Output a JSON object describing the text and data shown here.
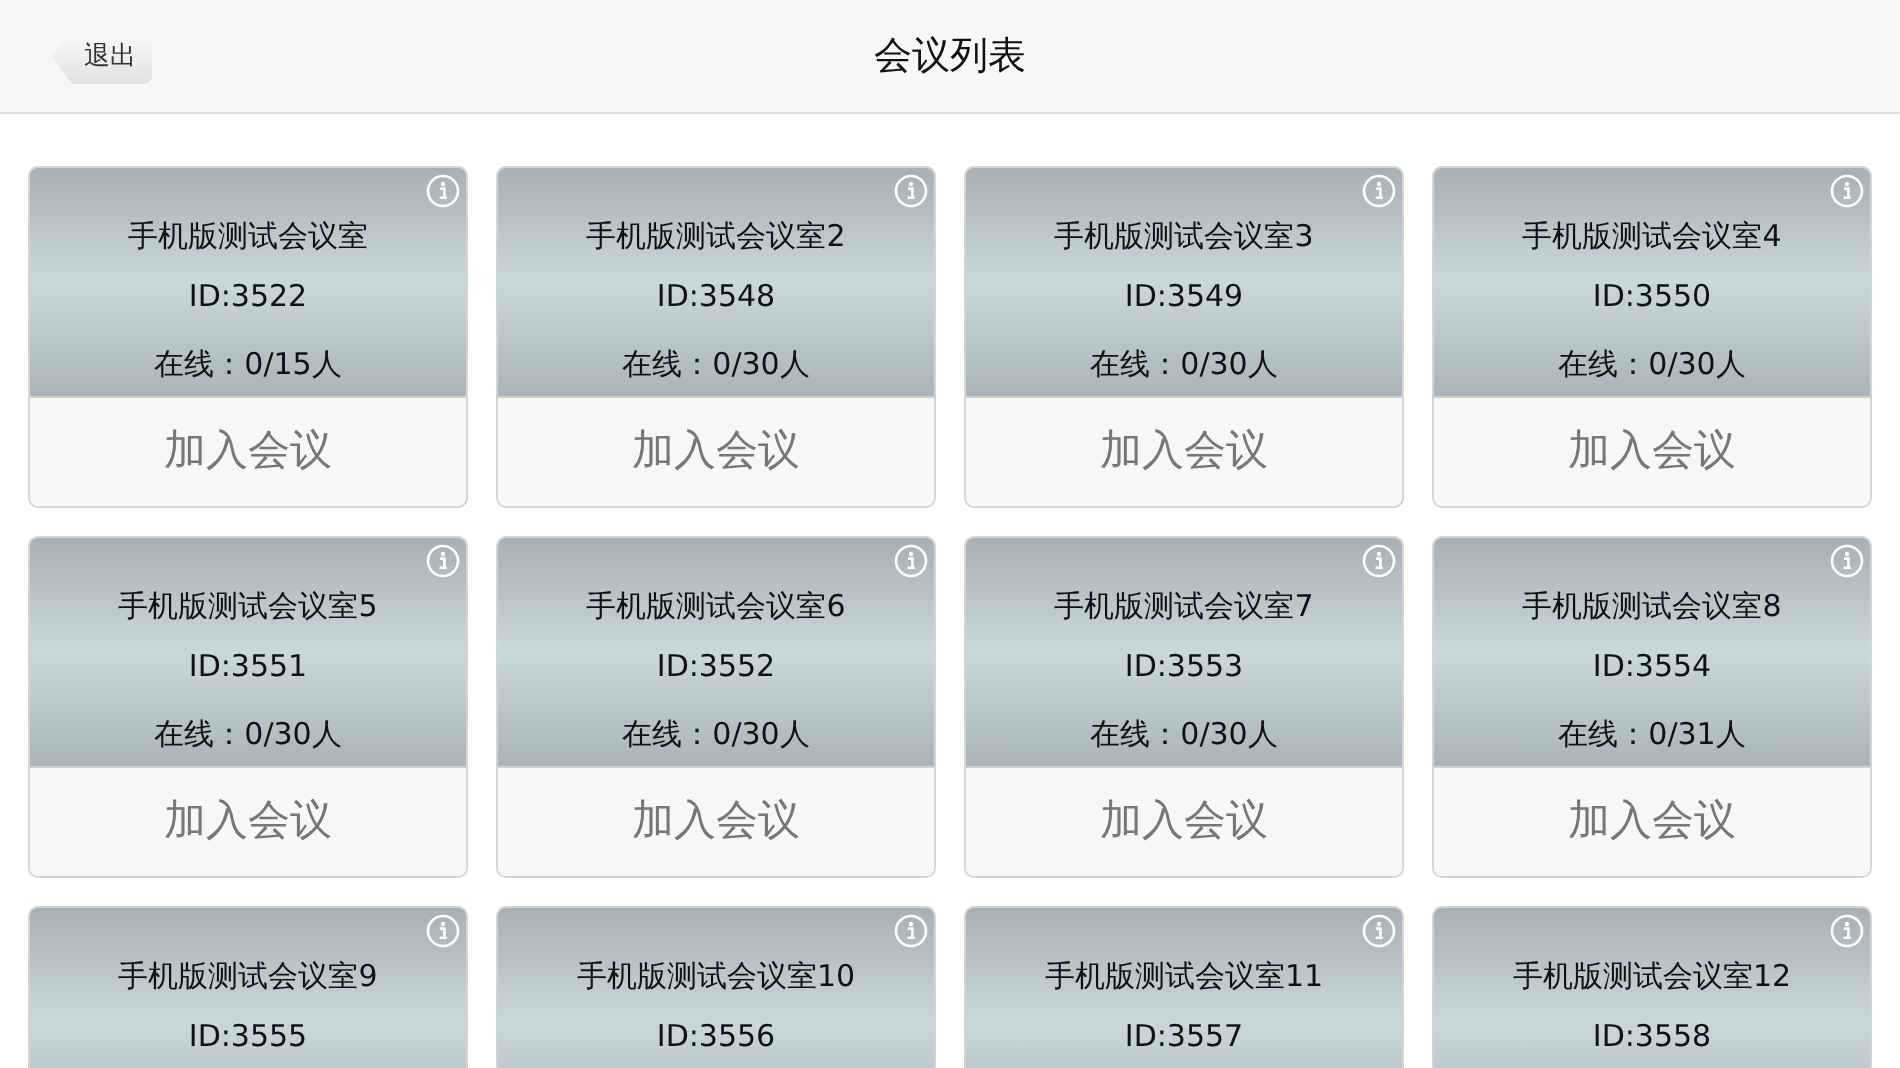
{
  "header": {
    "back": "退出",
    "title": "会议列表"
  },
  "rooms": [
    {
      "name": "手机版测试会议室",
      "id": "ID:3522",
      "online": "在线：0/15人",
      "join": "加入会议"
    },
    {
      "name": "手机版测试会议室2",
      "id": "ID:3548",
      "online": "在线：0/30人",
      "join": "加入会议"
    },
    {
      "name": "手机版测试会议室3",
      "id": "ID:3549",
      "online": "在线：0/30人",
      "join": "加入会议"
    },
    {
      "name": "手机版测试会议室4",
      "id": "ID:3550",
      "online": "在线：0/30人",
      "join": "加入会议"
    },
    {
      "name": "手机版测试会议室5",
      "id": "ID:3551",
      "online": "在线：0/30人",
      "join": "加入会议"
    },
    {
      "name": "手机版测试会议室6",
      "id": "ID:3552",
      "online": "在线：0/30人",
      "join": "加入会议"
    },
    {
      "name": "手机版测试会议室7",
      "id": "ID:3553",
      "online": "在线：0/30人",
      "join": "加入会议"
    },
    {
      "name": "手机版测试会议室8",
      "id": "ID:3554",
      "online": "在线：0/31人",
      "join": "加入会议"
    },
    {
      "name": "手机版测试会议室9",
      "id": "ID:3555"
    },
    {
      "name": "手机版测试会议室10",
      "id": "ID:3556"
    },
    {
      "name": "手机版测试会议室11",
      "id": "ID:3557"
    },
    {
      "name": "手机版测试会议室12",
      "id": "ID:3558"
    }
  ]
}
